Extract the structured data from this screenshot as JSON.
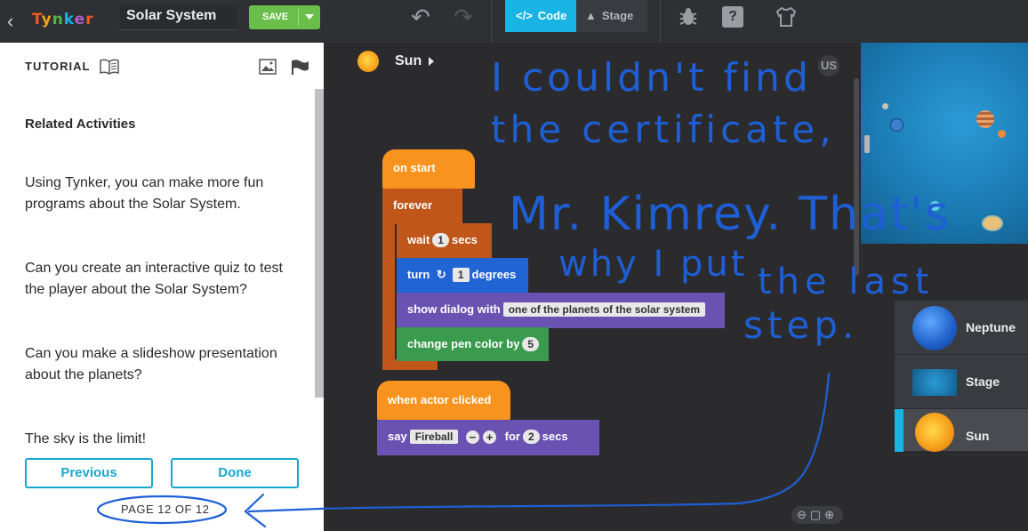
{
  "topbar": {
    "logo": [
      "T",
      "y",
      "n",
      "k",
      "e",
      "r"
    ],
    "project_title": "Solar System",
    "save_label": "SAVE",
    "tab_code": "Code",
    "tab_stage": "Stage",
    "help_glyph": "?"
  },
  "icons": {
    "back": "chevron-left-icon",
    "undo": "undo-icon",
    "redo": "redo-icon",
    "code": "code-icon",
    "stage": "image-icon",
    "bug": "bug-icon",
    "help": "help-icon",
    "costume": "shirt-icon"
  },
  "tutorial": {
    "heading": "TUTORIAL",
    "subheading": "Related Activities",
    "paragraphs": [
      "Using Tynker, you can make more fun programs about the Solar System.",
      "Can you create an interactive quiz to test the player about the Solar System?",
      "Can you make a slideshow presentation about the planets?",
      "The sky is the limit!"
    ],
    "prev_label": "Previous",
    "done_label": "Done",
    "page_indicator": "PAGE 12 OF 12"
  },
  "code": {
    "actor": "Sun",
    "badge": "US",
    "blocks": {
      "on_start": "on start",
      "forever": "forever",
      "wait_label": "wait",
      "wait_value": "1",
      "wait_unit": "secs",
      "turn_label": "turn",
      "turn_value": "1",
      "turn_unit": "degrees",
      "dialog_label": "show dialog with",
      "dialog_value": "one of the planets of the solar system",
      "pen_label": "change pen color by",
      "pen_value": "5",
      "when_clicked": "when actor clicked",
      "say_label": "say",
      "say_value": "Fireball",
      "say_for": "for",
      "say_seconds": "2",
      "say_unit": "secs"
    }
  },
  "actors": [
    {
      "name": "Neptune",
      "selected": false
    },
    {
      "name": "Stage",
      "selected": false
    },
    {
      "name": "Sun",
      "selected": true
    }
  ],
  "handwritten_note": [
    "I couldn't find",
    "the certificate,",
    "Mr. Kimrey. That's",
    "why I put",
    "the last",
    "step."
  ],
  "colors": {
    "accent": "#19b4e3",
    "save": "#6abf4b",
    "ink": "#1f5fd6"
  }
}
